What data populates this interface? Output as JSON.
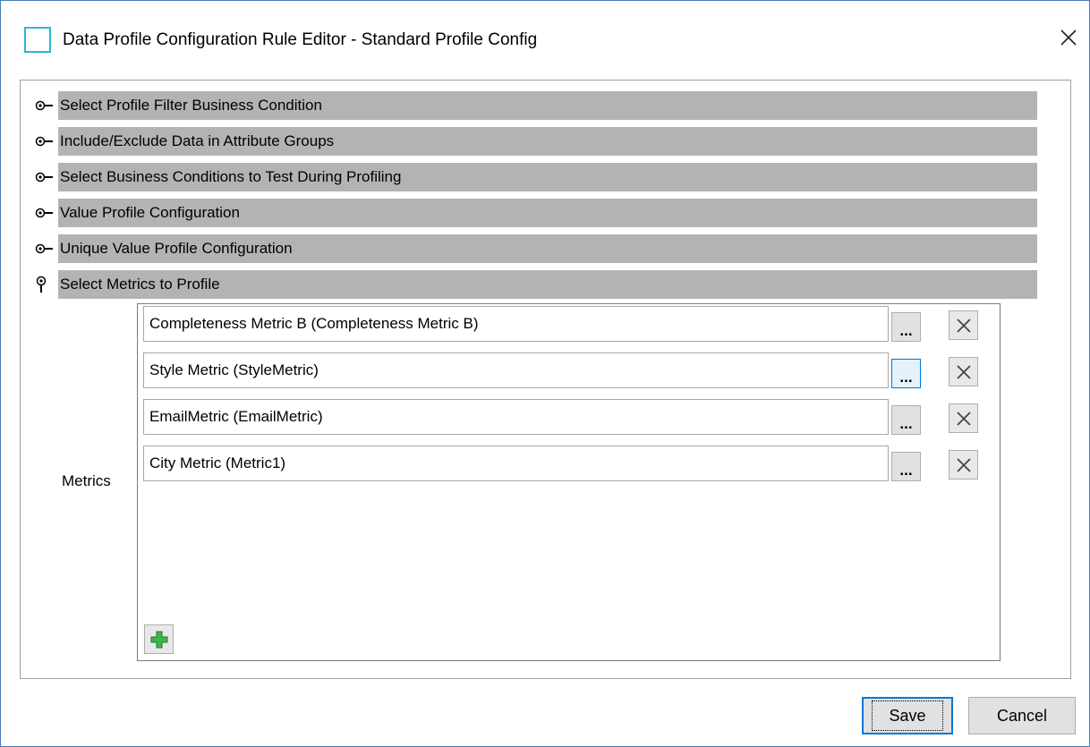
{
  "window": {
    "title": "Data Profile Configuration Rule Editor - Standard Profile Config",
    "close_icon": "close-icon"
  },
  "sections": [
    {
      "label": "Select Profile Filter Business Condition",
      "state": "collapsed",
      "icon": "expand-key-icon"
    },
    {
      "label": "Include/Exclude Data in Attribute Groups",
      "state": "collapsed",
      "icon": "expand-key-icon"
    },
    {
      "label": "Select Business Conditions to Test During Profiling",
      "state": "collapsed",
      "icon": "expand-key-icon"
    },
    {
      "label": "Value Profile Configuration",
      "state": "collapsed",
      "icon": "expand-key-icon"
    },
    {
      "label": "Unique Value Profile Configuration",
      "state": "collapsed",
      "icon": "expand-key-icon"
    },
    {
      "label": "Select Metrics to Profile",
      "state": "expanded",
      "icon": "collapse-key-icon"
    }
  ],
  "metrics": {
    "label": "Metrics",
    "items": [
      {
        "value": "Completeness Metric B (Completeness Metric B)",
        "browse_label": "..."
      },
      {
        "value": "Style Metric (StyleMetric)",
        "browse_label": "..."
      },
      {
        "value": "EmailMetric (EmailMetric)",
        "browse_label": "..."
      },
      {
        "value": "City Metric (Metric1)",
        "browse_label": "..."
      }
    ]
  },
  "footer": {
    "save_label": "Save",
    "cancel_label": "Cancel"
  },
  "colors": {
    "section_bar": "#b3b3b3",
    "accent": "#0078d7",
    "add_icon_green": "#3cb44b"
  }
}
